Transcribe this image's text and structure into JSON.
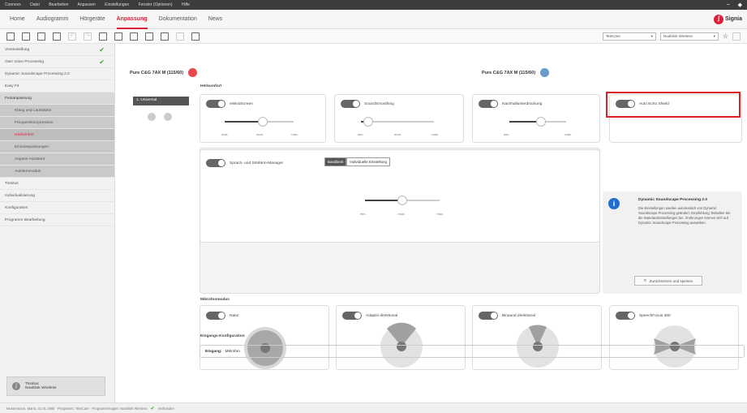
{
  "titlebar": {
    "menu": [
      "Connexx",
      "Datei",
      "Bearbeiten",
      "Anpassen",
      "Einstellungen",
      "Fenster (Optionen)",
      "Hilfe"
    ],
    "controls": [
      "–",
      "◆"
    ]
  },
  "tabs": [
    {
      "label": "Home"
    },
    {
      "label": "Audiogramm"
    },
    {
      "label": "Hörgeräte"
    },
    {
      "label": "Anpassung",
      "active": true
    },
    {
      "label": "Dokumentation"
    },
    {
      "label": "News"
    }
  ],
  "brand": "Signia",
  "toolbar": {
    "dropdown1": "TeleCare",
    "dropdown2": "Noahlink Wireless"
  },
  "sidebar": {
    "items": [
      {
        "label": "Voreinstellung",
        "done": true
      },
      {
        "label": "Own Voice Processing",
        "done": true
      },
      {
        "label": "Dynamic Soundscape Processing 2.0"
      },
      {
        "label": "Easy Fit"
      },
      {
        "label": "Feinanpassung",
        "type": "head"
      },
      {
        "label": "Klang und Lautstärke",
        "type": "sub"
      },
      {
        "label": "Frequenzkompression",
        "type": "sub"
      },
      {
        "label": "Hörkomfort",
        "type": "sub",
        "active": true
      },
      {
        "label": "Einzelanpassungen",
        "type": "sub"
      },
      {
        "label": "Anpass-Assistent",
        "type": "sub"
      },
      {
        "label": "Autolernmodus",
        "type": "sub"
      },
      {
        "label": "Tinnitus"
      },
      {
        "label": "Individualisierung"
      },
      {
        "label": "Konfiguration"
      },
      {
        "label": "Programm Bearbeitung"
      }
    ],
    "bottom": {
      "title": "Tinnitus",
      "sub": "Noahlink Wireless"
    }
  },
  "devices": {
    "left": "Pure C&G 7AX M (115/60)",
    "right": "Pure C&G 7AX M (115/60)"
  },
  "program": "1. Universal",
  "section_comfort": "Hörkomfort",
  "comfort_cards": [
    {
      "label": "eWindScreen",
      "ticks": [
        "max.",
        "mod.",
        "max."
      ],
      "level": 0.55
    },
    {
      "label": "SoundSmoothing",
      "ticks": [
        "min.",
        "mod.",
        "max."
      ],
      "level": 0.1
    },
    {
      "label": "Nachhallunterdrückung",
      "ticks": [
        "min.",
        "max."
      ],
      "level": 0.55
    },
    {
      "label": "Auto Echo Shield"
    }
  ],
  "speech_card": {
    "label": "Sprach- und Störlärm-Manager",
    "seg": [
      "Bandbreit",
      "Individuelle Einstellung"
    ],
    "ticks": [
      "min.",
      "mod.",
      "max."
    ],
    "level": 0.5
  },
  "info": {
    "title": "Dynamic Soundscape Processing 2.0",
    "text": "Die Einstellungen werden automatisch von Dynamic Soundscape Processing geändert. Empfehlung: Behalten Sie die Standardeinstellungen bei. Änderungen können sich auf Dynamic Soundscape Processing auswirken.",
    "button": "Zurücksetzen und speisen"
  },
  "section_mic": "Mikrofonmodus",
  "mic_cards": [
    {
      "label": "Natur"
    },
    {
      "label": "Adaptiv direktional"
    },
    {
      "label": "Binaural direktional"
    },
    {
      "label": "SpeechFocus 360"
    }
  ],
  "section_input": "Eingangs-Konfiguration",
  "input": {
    "label": "Eingang:",
    "value": "Mikrofon"
  },
  "status": {
    "text": "Mustermann, Maria, 01.01.1960 · Programm: TeleCare · Programmmappe: Noahlink Wireless",
    "check": "✔",
    "end": "Verbunden"
  },
  "colors": {
    "accent": "#d9203a",
    "info": "#1f6fd0",
    "highlight": "#e02020"
  }
}
